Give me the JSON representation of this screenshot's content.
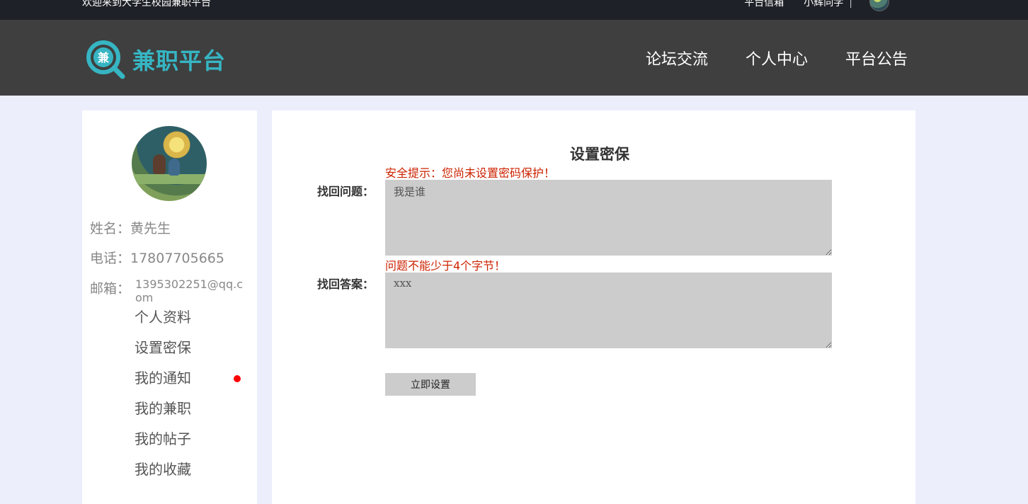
{
  "topbar": {
    "welcome": "欢迎来到大学生校园兼职平台",
    "mailbox": "平台信箱",
    "username": "小辉同学",
    "separator": "|"
  },
  "header": {
    "logo_char": "兼",
    "logo_text": "兼职平台",
    "nav": [
      "论坛交流",
      "个人中心",
      "平台公告"
    ]
  },
  "sidebar": {
    "name_row": "姓名：黄先生",
    "phone_row": "电话：17807705665",
    "email_label": "邮箱：",
    "email_value": "1395302251@qq.com",
    "menu": [
      "个人资料",
      "设置密保",
      "我的通知",
      "我的兼职",
      "我的帖子",
      "我的收藏"
    ],
    "notification_dot_color": "#ff0000"
  },
  "form": {
    "title": "设置密保",
    "security_hint": "安全提示：您尚未设置密码保护！",
    "question_label": "找回问题：",
    "question_value": "我是谁",
    "question_error": "问题不能少于4个字节！",
    "answer_label": "找回答案：",
    "answer_value": "xxx",
    "submit_label": "立即设置",
    "hint_color": "#cc2200"
  },
  "colors": {
    "logo_accent": "#36b5c3",
    "topbar_bg": "#1e2127",
    "navbar_bg": "#3f3f3f",
    "page_bg": "#eceefc"
  }
}
